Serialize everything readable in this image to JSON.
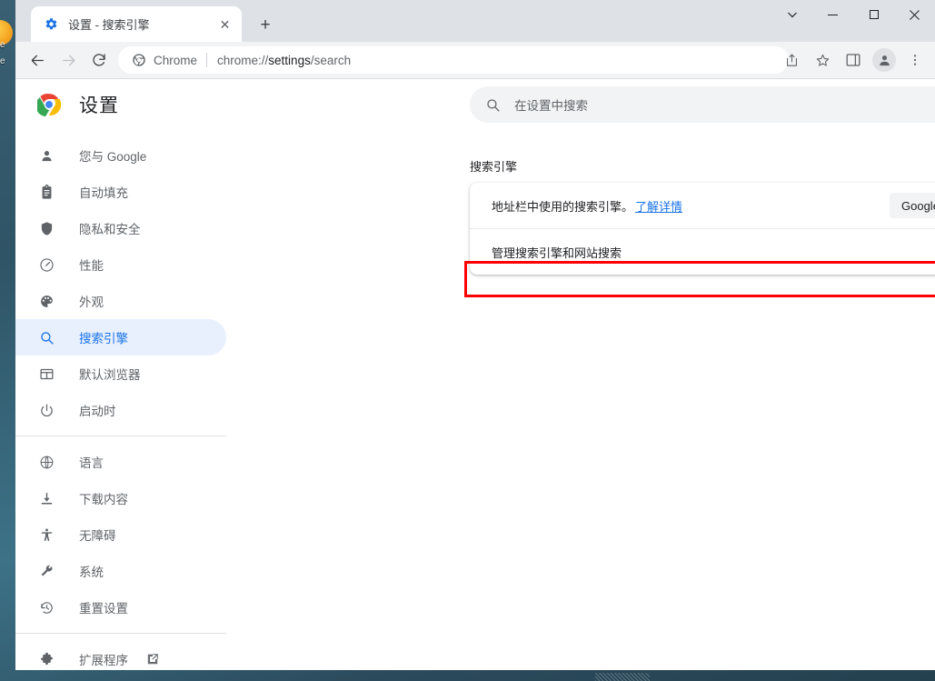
{
  "desktop": {
    "label_1": "e",
    "label_2": "e"
  },
  "browser": {
    "tab": {
      "title": "设置 - 搜索引擎",
      "favicon": "gear-icon",
      "close_label": "✕"
    },
    "new_tab_label": "+",
    "window_controls": {
      "tab_search": "⌄",
      "minimize": "—",
      "maximize": "▢",
      "close": "✕"
    },
    "toolbar": {
      "back": "back-arrow-icon",
      "forward": "forward-arrow-icon",
      "reload": "reload-icon",
      "omnibox_chip": "Chrome",
      "omnibox_url_prefix": "chrome://",
      "omnibox_url_bold": "settings",
      "omnibox_url_suffix": "/search",
      "share": "share-icon",
      "bookmark": "star-icon",
      "side_panel": "side-panel-icon",
      "profile": "avatar-icon",
      "menu": "three-dot-menu-icon"
    }
  },
  "settings": {
    "title": "设置",
    "search": {
      "placeholder": "在设置中搜索"
    },
    "sidebar": {
      "groups": [
        {
          "items": [
            {
              "label": "您与 Google",
              "icon": "person-icon",
              "selected": false
            },
            {
              "label": "自动填充",
              "icon": "clipboard-icon",
              "selected": false
            },
            {
              "label": "隐私和安全",
              "icon": "shield-icon",
              "selected": false
            },
            {
              "label": "性能",
              "icon": "speedometer-icon",
              "selected": false
            },
            {
              "label": "外观",
              "icon": "palette-icon",
              "selected": false
            },
            {
              "label": "搜索引擎",
              "icon": "search-icon",
              "selected": true
            },
            {
              "label": "默认浏览器",
              "icon": "browser-window-icon",
              "selected": false
            },
            {
              "label": "启动时",
              "icon": "power-icon",
              "selected": false
            }
          ]
        },
        {
          "items": [
            {
              "label": "语言",
              "icon": "globe-icon",
              "selected": false
            },
            {
              "label": "下载内容",
              "icon": "download-icon",
              "selected": false
            },
            {
              "label": "无障碍",
              "icon": "accessibility-icon",
              "selected": false
            },
            {
              "label": "系统",
              "icon": "wrench-icon",
              "selected": false
            },
            {
              "label": "重置设置",
              "icon": "history-restore-icon",
              "selected": false
            }
          ]
        },
        {
          "items": [
            {
              "label": "扩展程序",
              "icon": "puzzle-icon",
              "selected": false,
              "external": true
            }
          ]
        }
      ]
    },
    "section": {
      "title": "搜索引擎",
      "rows": {
        "default_engine": {
          "label": "地址栏中使用的搜索引擎。",
          "learn_more": "了解详情",
          "selected_value": "Google"
        },
        "manage_engines": {
          "label": "管理搜索引擎和网站搜索"
        }
      }
    }
  },
  "highlight": {
    "color": "#ff0000"
  }
}
